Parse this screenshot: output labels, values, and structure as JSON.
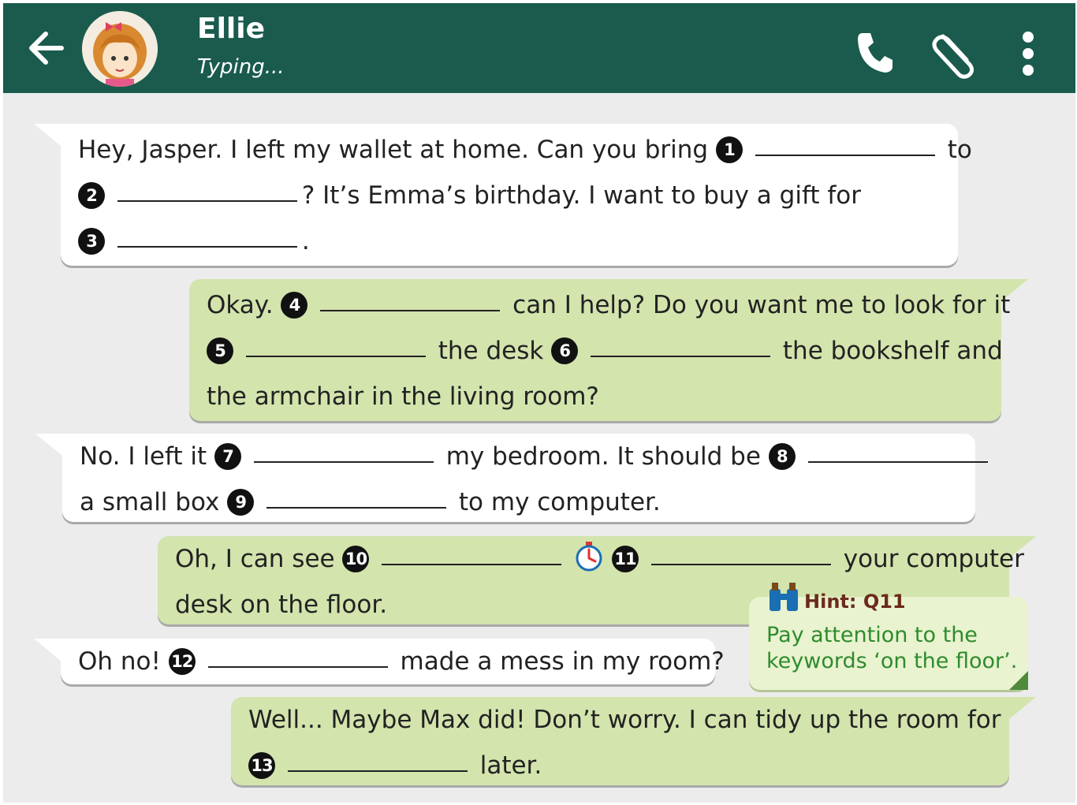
{
  "header": {
    "contact_name": "Ellie",
    "status": "Typing...",
    "icons": [
      "back-arrow-icon",
      "phone-icon",
      "paperclip-icon",
      "more-vertical-icon"
    ],
    "bar_color": "#1a5b4e"
  },
  "messages": [
    {
      "sender": "incoming",
      "lines": [
        [
          "Hey, Jasper. I left my wallet at home. Can you bring",
          "1",
          "to"
        ],
        [
          "2",
          "? It’s Emma’s birthday. I want to buy a gift for"
        ],
        [
          "3",
          "."
        ]
      ]
    },
    {
      "sender": "outgoing",
      "lines": [
        [
          "Okay.",
          "4",
          "can I help? Do you want me to look for it"
        ],
        [
          "5",
          "the desk",
          "6",
          "the bookshelf and"
        ],
        [
          "the armchair in the living room?"
        ]
      ]
    },
    {
      "sender": "incoming",
      "lines": [
        [
          "No. I left it",
          "7",
          "my bedroom. It should be",
          "8"
        ],
        [
          "a small box",
          "9",
          "to my computer."
        ]
      ]
    },
    {
      "sender": "outgoing",
      "lines": [
        [
          "Oh, I can see",
          "10",
          "11",
          "your computer"
        ],
        [
          "desk on the floor."
        ]
      ]
    },
    {
      "sender": "incoming",
      "lines": [
        [
          "Oh no!",
          "12",
          "made a mess in my room?"
        ]
      ]
    },
    {
      "sender": "outgoing",
      "lines": [
        [
          "Well... Maybe Max did! Don’t worry. I can tidy up the room for"
        ],
        [
          "13",
          "later."
        ]
      ]
    }
  ],
  "hint": {
    "title": "Hint: Q11",
    "line1": "Pay attention to the",
    "line2": "keywords ‘on the floor’."
  },
  "colors": {
    "incoming_bubble": "#ffffff",
    "outgoing_bubble": "#d3e4ad",
    "hint_text": "#2e8b2e",
    "background": "#ececec"
  }
}
